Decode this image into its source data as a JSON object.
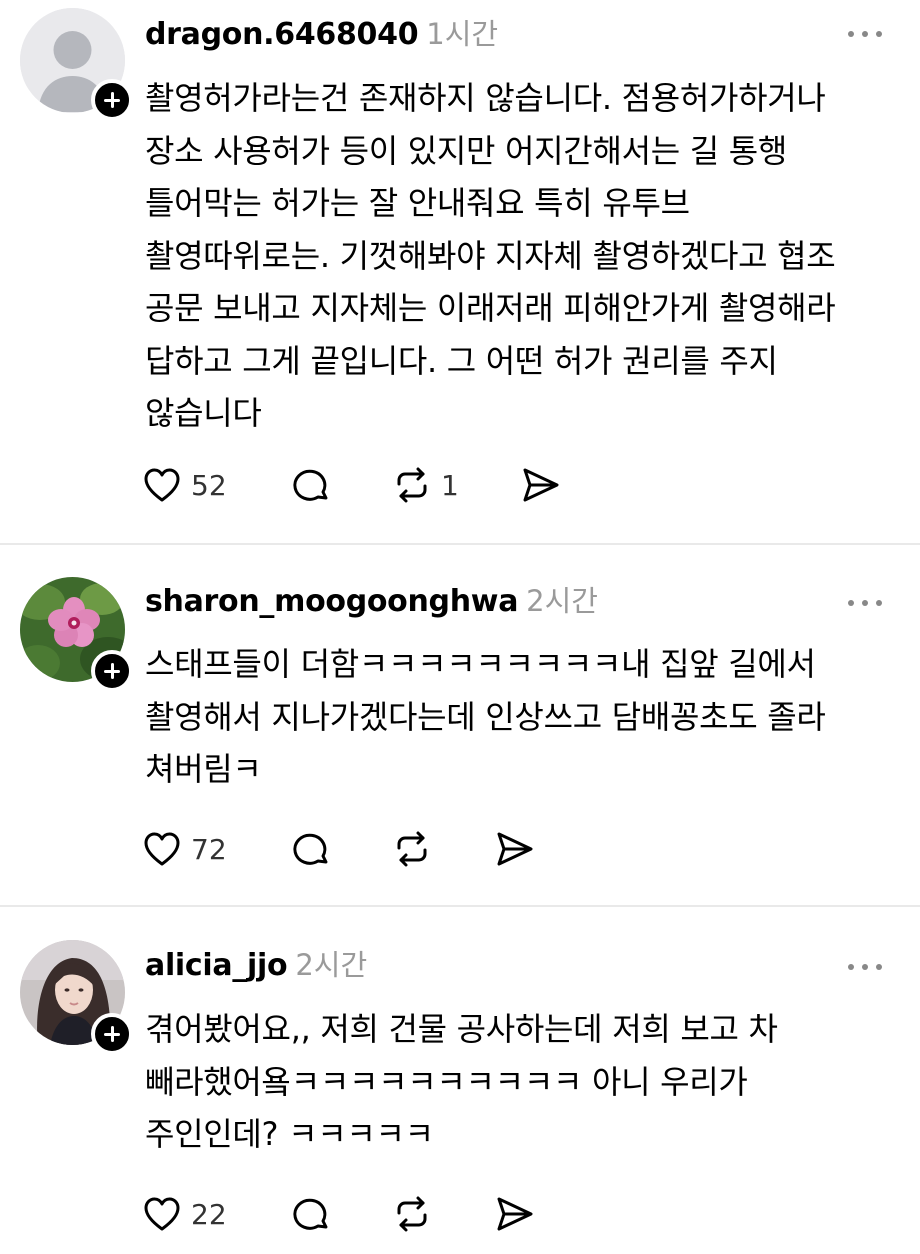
{
  "posts": [
    {
      "username": "dragon.6468040",
      "time": "1시간",
      "avatar": "default-profile-icon",
      "lines": [
        "촬영허가라는건 존재하지 않습니다. 점용허가하거나",
        "장소 사용허가 등이 있지만 어지간해서는 길 통행",
        "틀어막는 허가는 잘 안내줘요 특히 유투브",
        "촬영따위로는. 기껏해봐야 지자체 촬영하겠다고 협조",
        "공문 보내고 지자체는 이래저래 피해안가게 촬영해라",
        "답하고 그게 끝입니다. 그 어떤 허가 권리를 주지",
        "않습니다"
      ],
      "likes": "52",
      "reposts": "1"
    },
    {
      "username": "sharon_moogoonghwa",
      "time": "2시간",
      "avatar": "hibiscus-flower-photo",
      "lines": [
        "스태프들이 더함ㅋㅋㅋㅋㅋㅋㅋㅋㅋ내 집앞 길에서",
        "촬영해서 지나가겠다는데 인상쓰고 담배꽁초도 졸라",
        "쳐버림ㅋ"
      ],
      "likes": "72",
      "reposts": ""
    },
    {
      "username": "alicia_jjo",
      "time": "2시간",
      "avatar": "woman-portrait-photo",
      "lines": [
        "겪어봤어요,, 저희 건물 공사하는데 저희 보고 차",
        "빼라했어욬ㅋㅋㅋㅋㅋㅋㅋㅋㅋㅋ 아니 우리가",
        "주인인데? ㅋㅋㅋㅋㅋ"
      ],
      "likes": "22",
      "reposts": ""
    }
  ]
}
